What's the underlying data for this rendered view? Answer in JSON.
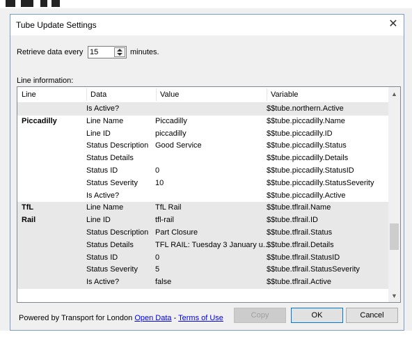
{
  "dialog": {
    "title": "Tube Update Settings",
    "close_glyph": "✕"
  },
  "retrieve": {
    "label_before": "Retrieve data every",
    "value": "15",
    "label_after": "minutes."
  },
  "line_info_label": "Line information:",
  "table": {
    "headers": [
      "Line",
      "Data",
      "Value",
      "Variable"
    ],
    "rows": [
      {
        "line": "",
        "data": "Is Active?",
        "value": "",
        "variable": "$$tube.northern.Active"
      },
      {
        "line": "Piccadilly",
        "data": "Line Name",
        "value": "Piccadilly",
        "variable": "$$tube.piccadilly.Name"
      },
      {
        "line": "",
        "data": "Line ID",
        "value": "piccadilly",
        "variable": "$$tube.piccadilly.ID"
      },
      {
        "line": "",
        "data": "Status Description",
        "value": "Good Service",
        "variable": "$$tube.piccadilly.Status"
      },
      {
        "line": "",
        "data": "Status Details",
        "value": "",
        "variable": "$$tube.piccadilly.Details"
      },
      {
        "line": "",
        "data": "Status ID",
        "value": "0",
        "variable": "$$tube.piccadilly.StatusID"
      },
      {
        "line": "",
        "data": "Status Severity",
        "value": "10",
        "variable": "$$tube.piccadilly.StatusSeverity"
      },
      {
        "line": "",
        "data": "Is Active?",
        "value": "",
        "variable": "$$tube.piccadilly.Active"
      },
      {
        "line": "TfL",
        "data": "Line Name",
        "value": "TfL Rail",
        "variable": "$$tube.tflrail.Name"
      },
      {
        "line": "Rail",
        "data": "Line ID",
        "value": "tfl-rail",
        "variable": "$$tube.tflrail.ID"
      },
      {
        "line": "",
        "data": "Status Description",
        "value": "Part Closure",
        "variable": "$$tube.tflrail.Status"
      },
      {
        "line": "",
        "data": "Status Details",
        "value": "TFL RAIL: Tuesday 3 January u...",
        "variable": "$$tube.tflrail.Details"
      },
      {
        "line": "",
        "data": "Status ID",
        "value": "0",
        "variable": "$$tube.tflrail.StatusID"
      },
      {
        "line": "",
        "data": "Status Severity",
        "value": "5",
        "variable": "$$tube.tflrail.StatusSeverity"
      },
      {
        "line": "",
        "data": "Is Active?",
        "value": "false",
        "variable": "$$tube.tflrail.Active"
      }
    ],
    "shaded_rows": [
      0,
      8,
      9,
      10,
      11,
      12,
      13,
      14
    ],
    "shade_color": "#e8e8e8"
  },
  "footer": {
    "powered_by": "Powered by Transport for London",
    "open_data_link": "Open Data",
    "separator": "-",
    "terms_link": "Terms of Use",
    "copy_label": "Copy",
    "ok_label": "OK",
    "cancel_label": "Cancel"
  },
  "colors": {
    "accent": "#0078d7",
    "link": "#0000ee"
  }
}
